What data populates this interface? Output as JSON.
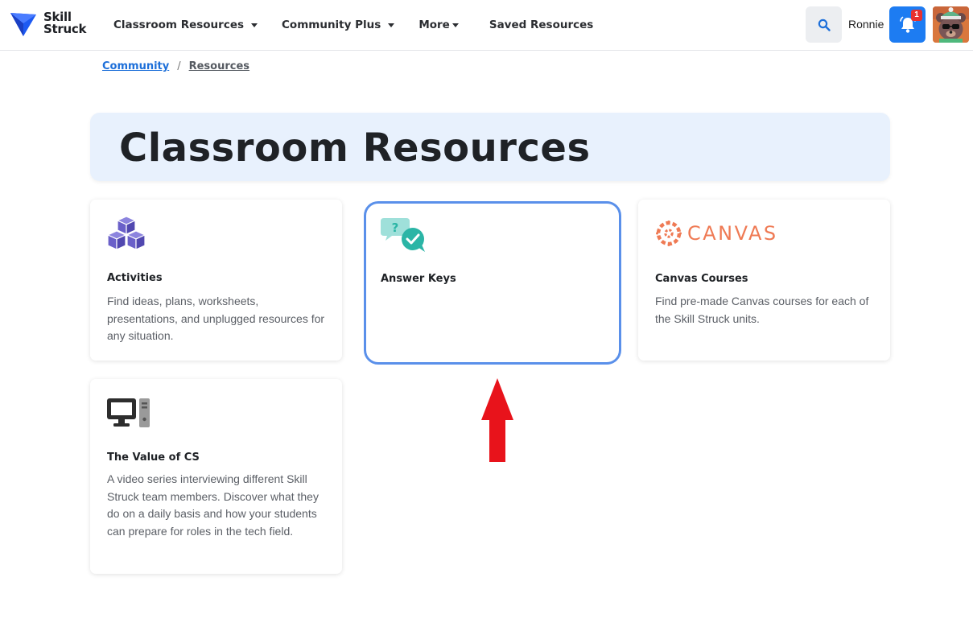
{
  "brand": {
    "line1": "Skill",
    "line2": "Struck",
    "color": "#1d5af2"
  },
  "nav": {
    "items": [
      {
        "label": "Classroom Resources",
        "has_dropdown": true
      },
      {
        "label": "Community Plus",
        "has_dropdown": true
      },
      {
        "label": "More",
        "has_dropdown": true
      },
      {
        "label": "Saved Resources",
        "has_dropdown": false
      }
    ]
  },
  "header": {
    "search_icon": "search-icon",
    "user_name": "Ronnie",
    "notification_count": "1",
    "accent_color": "#1d7cf2"
  },
  "breadcrumb": {
    "parent": "Community",
    "separator": "/",
    "current": "Resources"
  },
  "hero": {
    "title": "Classroom Resources",
    "background": "#e8f1fd"
  },
  "cards": [
    {
      "icon": "cubes-icon",
      "title": "Activities",
      "description": "Find ideas, plans, worksheets, presentations, and unplugged resources for any situation."
    },
    {
      "icon": "chat-bubbles-check-icon",
      "title": "Answer Keys",
      "description": "",
      "highlighted": true
    },
    {
      "icon": "canvas-logo",
      "logo_text": "CANVAS",
      "title": "Canvas Courses",
      "description": "Find pre-made Canvas courses for each of the Skill Struck units."
    },
    {
      "icon": "desktop-computer-icon",
      "title": "The Value of CS",
      "description": "A video series interviewing different Skill Struck team members. Discover what they do on a daily basis and how your students can prepare for roles in the tech field."
    }
  ],
  "annotation": {
    "arrow_color": "#e8131b",
    "arrow_direction": "up"
  }
}
